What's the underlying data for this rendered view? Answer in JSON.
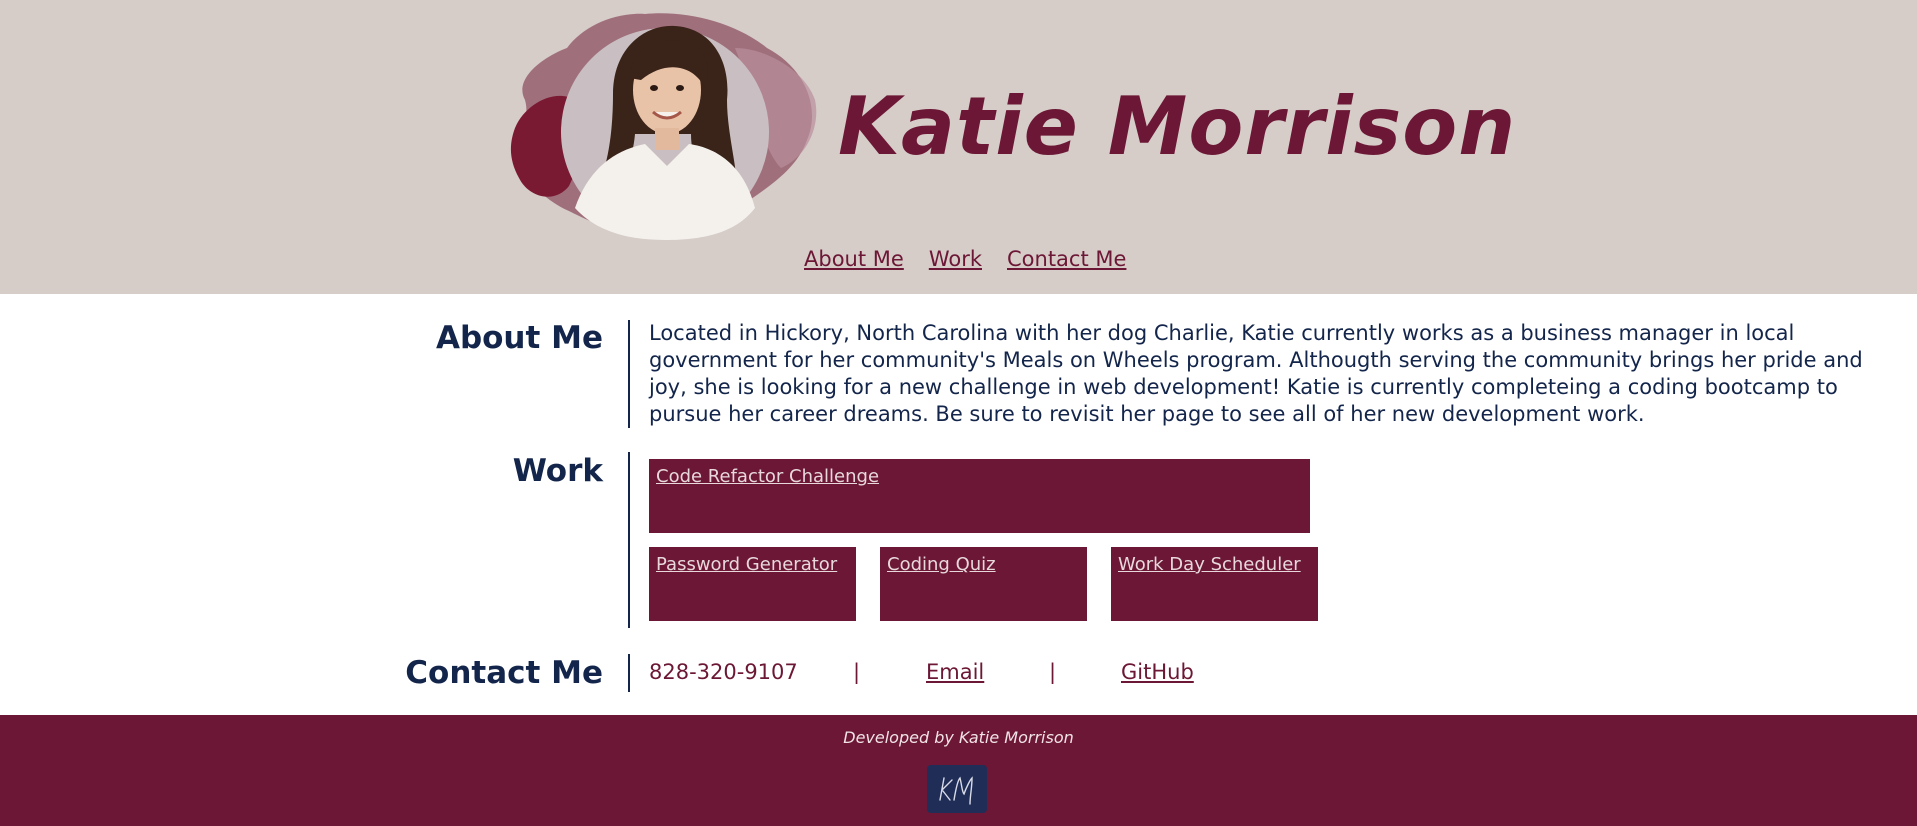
{
  "header": {
    "title": "Katie Morrison",
    "nav": [
      "About Me",
      "Work",
      "Contact Me"
    ]
  },
  "about": {
    "heading": "About Me",
    "text": "Located in Hickory, North Carolina with her dog Charlie, Katie currently works as a business manager in local government for her community's Meals on Wheels program. Althougth serving the community brings her pride and joy, she is looking for a new challenge in web development! Katie is currently completeing a coding bootcamp to pursue her career dreams. Be sure to revisit her page to see all of her new development work."
  },
  "work": {
    "heading": "Work",
    "projects": [
      "Code Refactor Challenge",
      "Password Generator",
      "Coding Quiz",
      "Work Day Scheduler"
    ]
  },
  "contact": {
    "heading": "Contact Me",
    "phone": "828-320-9107",
    "separator": "|",
    "email_label": "Email",
    "github_label": "GitHub"
  },
  "footer": {
    "text": "Developed by Katie Morrison",
    "logo_text": "KM"
  },
  "colors": {
    "header_bg": "#d6ccc8",
    "brand": "#6b1735",
    "heading": "#13254a",
    "footer_bg": "#6b1735"
  }
}
